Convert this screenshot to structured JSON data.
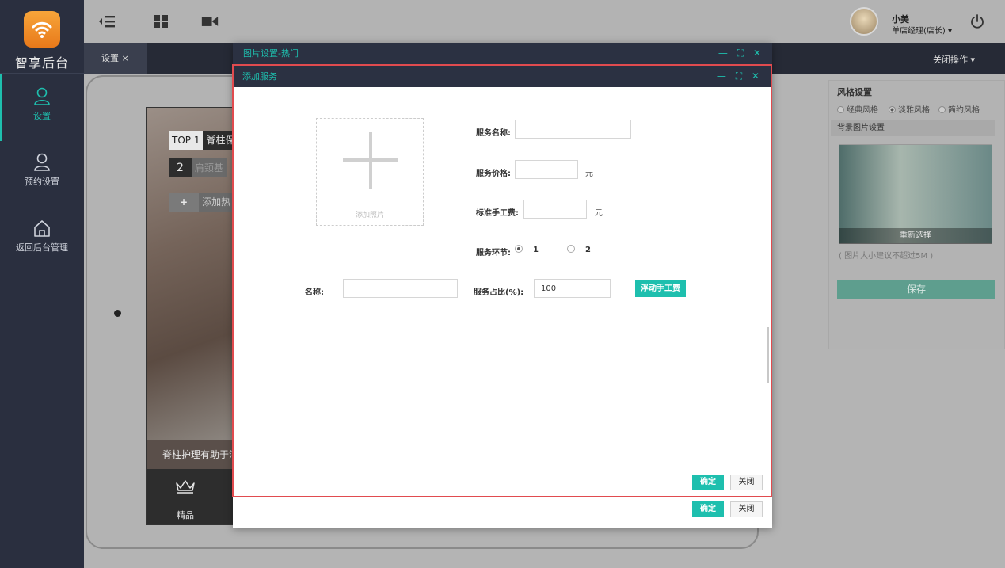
{
  "brand": {
    "name": "智享后台",
    "accent": "#1ebfae"
  },
  "sidebar": {
    "items": [
      {
        "label": "设置",
        "icon": "user-icon",
        "active": true
      },
      {
        "label": "预约设置",
        "icon": "user-icon",
        "active": false
      },
      {
        "label": "返回后台管理",
        "icon": "home-icon",
        "active": false
      }
    ]
  },
  "topbar": {
    "icons": [
      "menu-collapse-icon",
      "grid-icon",
      "video-icon"
    ],
    "user": {
      "name": "小美",
      "role": "单店经理(店长) ▾"
    },
    "power_icon": "power-icon"
  },
  "tabs": {
    "current": "设置 ×",
    "close_ops": "关闭操作 ▾"
  },
  "background_page": {
    "phone": {
      "row1_rank": "TOP 1",
      "row1_label": "脊柱保",
      "row2_rank": "2",
      "row2_label": "肩颈基",
      "add_label": "添加热",
      "caption": "脊柱护理有助于消",
      "nav_label": "精品"
    },
    "style_panel": {
      "title": "风格设置",
      "options": [
        "经典风格",
        "淡雅风格",
        "简约风格"
      ],
      "selected": "淡雅风格",
      "bg_title": "背景图片设置",
      "reselect": "重新选择",
      "hint": "( 图片大小建议不超过5M )",
      "save": "保存"
    }
  },
  "outer_modal": {
    "title": "图片设置-热门",
    "controls": "— ⛶ ✕",
    "confirm": "确定",
    "close": "关闭"
  },
  "inner_modal": {
    "title": "添加服务",
    "controls": "— ⛶ ✕",
    "upload_label": "添加照片",
    "service_name_label": "服务名称:",
    "service_name_value": "",
    "service_price_label": "服务价格:",
    "service_price_value": "",
    "price_unit": "元",
    "labor_fee_label": "标准手工费:",
    "labor_fee_value": "",
    "labor_unit": "元",
    "steps_label": "服务环节:",
    "step_options": [
      "1",
      "2"
    ],
    "step_selected": "1",
    "name_label": "名称:",
    "name_value": "",
    "ratio_label": "服务占比(%):",
    "ratio_value": "100",
    "float_fee_button": "浮动手工费",
    "confirm": "确定",
    "close": "关闭"
  }
}
